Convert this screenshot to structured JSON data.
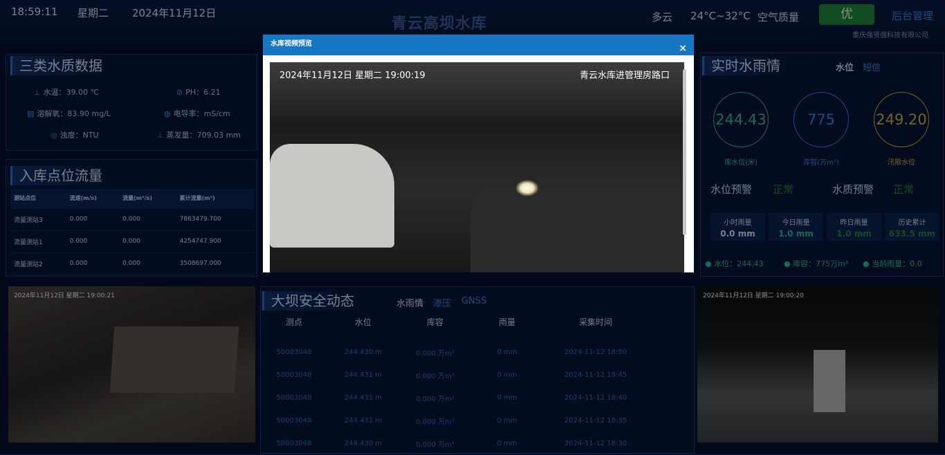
{
  "header": {
    "time": "18:59:11",
    "weekday": "星期二",
    "date": "2024年11月12日",
    "title": "青云高坝水库",
    "weather": "多云",
    "temperature": "24°C~32°C",
    "air_quality_label": "空气质量",
    "air_quality_value": "优",
    "admin_link": "后台管理",
    "company": "重庆强贤强科技有限公司"
  },
  "water_quality": {
    "title": "三类水质数据",
    "items": [
      {
        "icon": "thermometer-icon",
        "label": "水温：",
        "value": "39.00 ℃"
      },
      {
        "icon": "ph-icon",
        "label": "PH：",
        "value": "6.21"
      },
      {
        "icon": "oxygen-icon",
        "label": "溶解氧：",
        "value": "83.90 mg/L"
      },
      {
        "icon": "conductivity-icon",
        "label": "电导率：",
        "value": "mS/cm"
      },
      {
        "icon": "turbidity-icon",
        "label": "浊度：",
        "value": "NTU"
      },
      {
        "icon": "evaporation-icon",
        "label": "蒸发量：",
        "value": "709.03 mm"
      }
    ]
  },
  "inflow": {
    "title": "入库点位流量",
    "columns": [
      "测站点位",
      "流速(m/s)",
      "流量(m³/s)",
      "累计流量(m³)"
    ],
    "rows": [
      [
        "流量测站3",
        "0.000",
        "0.000",
        "7863479.700"
      ],
      [
        "流量测站1",
        "0.000",
        "0.000",
        "4254747.900"
      ],
      [
        "流量测站2",
        "0.000",
        "0.000",
        "3508697.000"
      ]
    ]
  },
  "modal": {
    "title": "水库视频预览",
    "close": "×",
    "video_timestamp": "2024年11月12日 星期二 19:00:19",
    "video_caption": "青云水库进管理房路口"
  },
  "realtime": {
    "title": "实时水雨情",
    "tabs": [
      "水位",
      "短信"
    ],
    "gauges": [
      {
        "value": "244.43",
        "label": "库水位(米)",
        "color": "#2bc39a"
      },
      {
        "value": "775",
        "label": "库容(万m³)",
        "color": "#2f8ce8"
      },
      {
        "value": "249.20",
        "label": "汛限水位",
        "color": "#d9b436"
      }
    ],
    "level_warning_label": "水位预警",
    "level_warning_value": "正常",
    "quality_warning_label": "水质预警",
    "quality_warning_value": "正常",
    "rain": [
      {
        "label": "小时雨量",
        "value": "0.0 mm",
        "color": "#dfe9ff"
      },
      {
        "label": "今日雨量",
        "value": "1.0 mm",
        "color": "#2bc39a"
      },
      {
        "label": "昨日雨量",
        "value": "1.0 mm",
        "color": "#1e8f3a"
      },
      {
        "label": "历史累计",
        "value": "633.5 mm",
        "color": "#1e8f3a"
      }
    ],
    "summary": [
      "水位：244.43",
      "库容：775万m³",
      "当前雨量：0.0"
    ]
  },
  "dam_safety": {
    "title": "大坝安全动态",
    "tabs": [
      "水雨情",
      "渗压",
      "GNSS"
    ],
    "columns": [
      "测点",
      "水位",
      "库容",
      "雨量",
      "采集时间"
    ],
    "rows": [
      [
        "50003048",
        "244.430 m",
        "0.000 万m³",
        "0 mm",
        "2024-11-12 18:50"
      ],
      [
        "50003048",
        "244.431 m",
        "0.000 万m³",
        "0 mm",
        "2024-11-12 18:45"
      ],
      [
        "50003048",
        "244.431 m",
        "0.000 万m³",
        "0 mm",
        "2024-11-12 18:40"
      ],
      [
        "50003048",
        "244.431 m",
        "0.000 万m³",
        "0 mm",
        "2024-11-12 18:35"
      ],
      [
        "50003048",
        "244.430 m",
        "0.000 万m³",
        "0 mm",
        "2024-11-12 18:30"
      ]
    ]
  },
  "cams": {
    "left_timestamp": "2024年11月12日 星期二 19:00:21",
    "right_timestamp": "2024年11月12日 星期二 19:00:20"
  }
}
